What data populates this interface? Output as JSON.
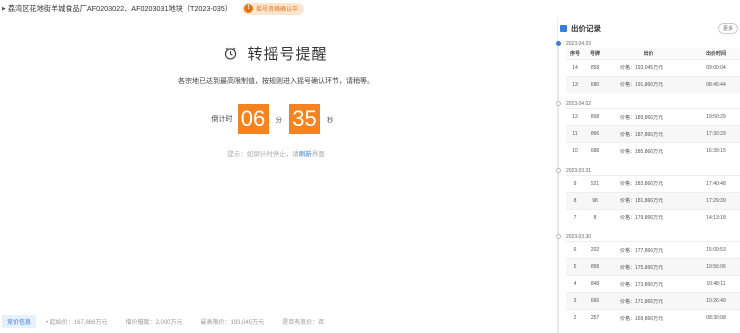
{
  "header": {
    "title": "荔湾区花地街羊城食品厂AF0203022、AF0203031地块（T2023-035）",
    "status_badge": "摇号资格确认中"
  },
  "main": {
    "heading": "转摇号提醒",
    "description": "各宗地已达到最高限制值，按规则进入摇号确认环节，请稍等。",
    "countdown": {
      "label": "倒计时",
      "minutes": "06",
      "minutes_unit": "分",
      "seconds": "35",
      "seconds_unit": "秒"
    },
    "hint": {
      "text": "提示：如倒计时停止，请",
      "link": "刷新",
      "suffix": "界面"
    }
  },
  "info_bar": {
    "tag": "竞价信息",
    "items": [
      "• 起始价：167,866万元",
      "增价幅度：2,000万元",
      "最高限价：193,045万元",
      "是否有底价：否"
    ]
  },
  "side": {
    "title": "出价记录",
    "more_button": "更多",
    "columns": [
      "序号",
      "号牌",
      "出价",
      "出价时间"
    ],
    "groups": [
      {
        "date": "2023.04.03",
        "rows": [
          [
            "14",
            "858",
            "价格：193,045万元",
            "09:00:04"
          ],
          [
            "13",
            "680",
            "价格：191,866万元",
            "08:45:44"
          ]
        ]
      },
      {
        "date": "2023.04.02",
        "rows": [
          [
            "12",
            "808",
            "价格：189,866万元",
            "19:50:29"
          ],
          [
            "11",
            "866",
            "价格：187,866万元",
            "17:30:29"
          ],
          [
            "10",
            "688",
            "价格：185,866万元",
            "16:39:15"
          ]
        ]
      },
      {
        "date": "2023.03.31",
        "rows": [
          [
            "9",
            "521",
            "价格：183,866万元",
            "17:40:48"
          ],
          [
            "8",
            "98",
            "价格：181,866万元",
            "17:29:39"
          ],
          [
            "7",
            "8",
            "价格：179,866万元",
            "14:13:18"
          ]
        ]
      },
      {
        "date": "2023.03.30",
        "rows": [
          [
            "6",
            "202",
            "价格：177,866万元",
            "15:09:53"
          ],
          [
            "5",
            "858",
            "价格：175,866万元",
            "10:56:06"
          ],
          [
            "4",
            "848",
            "价格：173,866万元",
            "10:48:11"
          ],
          [
            "3",
            "666",
            "价格：171,866万元",
            "10:26:49"
          ],
          [
            "2",
            "257",
            "价格：169,866万元",
            "08:30:08"
          ]
        ]
      }
    ]
  },
  "colors": {
    "accent_orange": "#f58420",
    "link_blue": "#3b7ddd",
    "badge_bg": "#fde6cf"
  }
}
